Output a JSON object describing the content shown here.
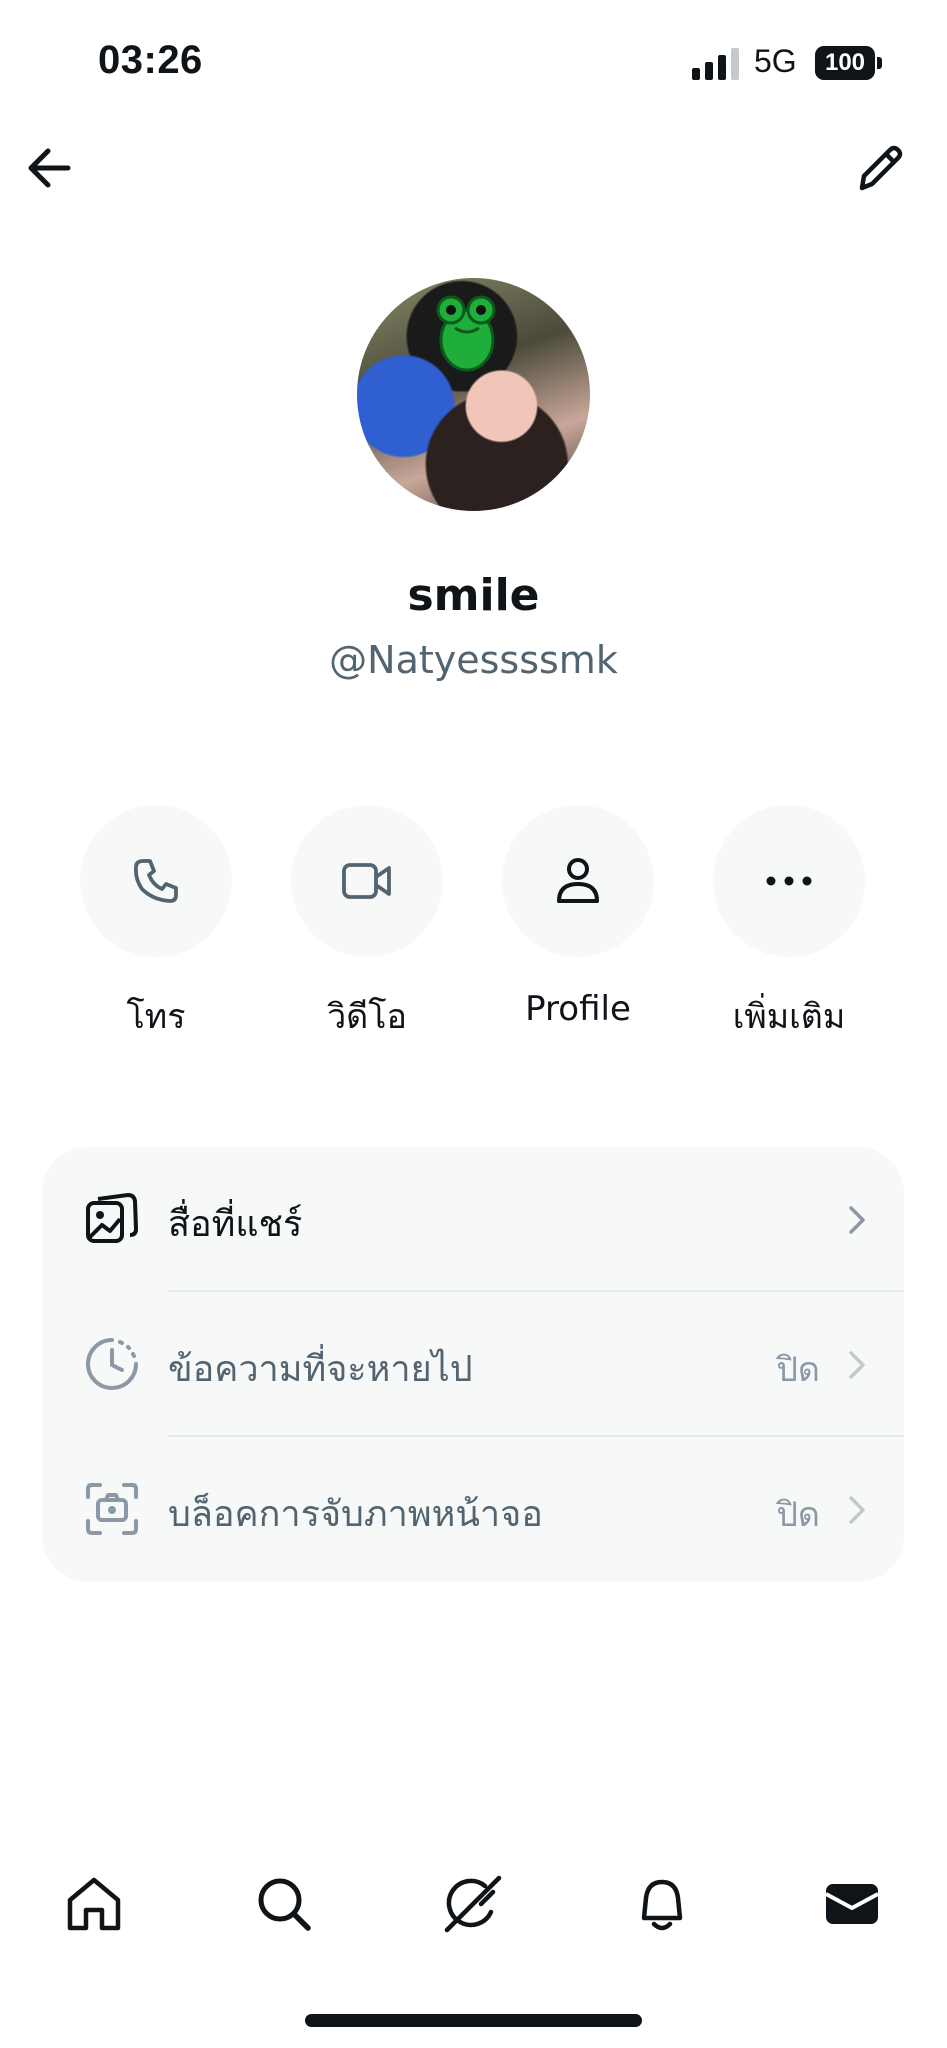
{
  "status_bar": {
    "time": "03:26",
    "network": "5G",
    "battery": "100"
  },
  "top_bar": {
    "back_icon": "arrow-left-icon",
    "edit_icon": "pencil-icon"
  },
  "profile": {
    "display_name": "smile",
    "handle": "@Natyessssmk"
  },
  "actions": [
    {
      "icon": "phone-icon",
      "label": "โทร"
    },
    {
      "icon": "video-icon",
      "label": "วิดีโอ"
    },
    {
      "icon": "person-icon",
      "label": "Profile"
    },
    {
      "icon": "more-icon",
      "label": "เพิ่มเติม"
    }
  ],
  "settings": [
    {
      "icon": "media-icon",
      "label": "สื่อที่แชร์",
      "value": ""
    },
    {
      "icon": "timer-icon",
      "label": "ข้อความที่จะหายไป",
      "value": "ปิด"
    },
    {
      "icon": "screenshot-block-icon",
      "label": "บล็อคการจับภาพหน้าจอ",
      "value": "ปิด"
    }
  ],
  "bottom_nav": [
    {
      "icon": "home-icon"
    },
    {
      "icon": "search-icon"
    },
    {
      "icon": "grok-icon"
    },
    {
      "icon": "bell-icon"
    },
    {
      "icon": "mail-icon",
      "active": true
    }
  ],
  "colors": {
    "text": "#0f1419",
    "secondary": "#536471",
    "surface": "#f7f9f9",
    "muted_value": "#8b98a5"
  }
}
